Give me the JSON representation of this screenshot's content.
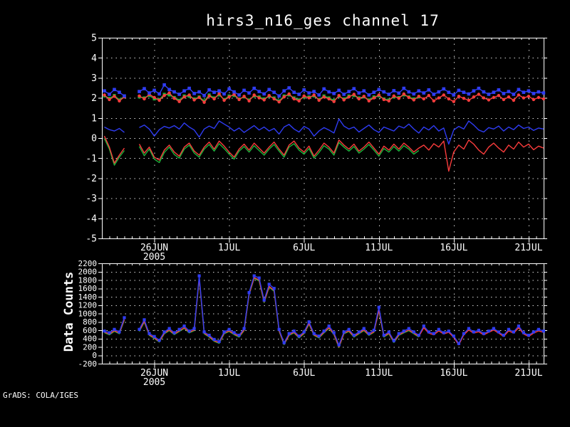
{
  "title": "hirs3_n16_ges channel 17",
  "attribution": "GrADS: COLA/IGES",
  "colors": {
    "background": "#000000",
    "axis": "#ffffff",
    "grid": "#d2d2d2",
    "blue": "#2f3cf2",
    "red": "#fa3c3c",
    "green": "#1eb43c"
  },
  "x_axis": {
    "range_days": [
      0,
      29.5
    ],
    "tick_days": [
      3.5,
      8.5,
      13.5,
      18.5,
      23.5,
      28.5
    ],
    "tick_labels": [
      "26JUN",
      "1JUL",
      "6JUL",
      "11JUL",
      "16JUL",
      "21JUL"
    ],
    "year_label": "2005",
    "points_start_day": 0.1667,
    "points_step_day": 0.3333
  },
  "chart_data": [
    {
      "type": "line",
      "title": "hirs3_n16_ges channel 17",
      "ylabel": "",
      "ylim": [
        -5,
        5
      ],
      "ytick_values": [
        5,
        4,
        3,
        2,
        1,
        0,
        -1,
        -2,
        -3,
        -4,
        -5
      ],
      "ytick_labels": [
        "5",
        "4",
        "3",
        "2",
        "1",
        "0",
        "-1",
        "-2",
        "-3",
        "-4",
        "-5"
      ],
      "grid": true,
      "legend": "none",
      "series": [
        {
          "name": "green_markers",
          "color": "green",
          "marker": "square",
          "marker_size": 4.2,
          "values": [
            2.1,
            1.98,
            2.12,
            1.9,
            2.08,
            null,
            null,
            2.05,
            2.0,
            2.12,
            1.95,
            1.92,
            2.18,
            2.15,
            2.02,
            1.88,
            2.1,
            2.08,
            1.95,
            2.05,
            1.85,
            2.15,
            2.0,
            2.15,
            1.92,
            2.1,
            2.12,
            1.95,
            2.05,
            1.9,
            2.1,
            2.05,
            1.95,
            2.08,
            2.0,
            1.85,
            2.1,
            2.15,
            2.0,
            1.9,
            2.05,
            2.05,
            2.1,
            1.92,
            2.1,
            2.0,
            1.88,
            2.08,
            1.95,
            2.1,
            2.12,
            2.0,
            2.05,
            1.9,
            2.05,
            2.1,
            1.95,
            1.9,
            2.05,
            2.02,
            2.15,
            2.05,
            1.95,
            2.05,
            null,
            null,
            null,
            null,
            null,
            null,
            null,
            null,
            null,
            null,
            null,
            null,
            null,
            null,
            null,
            null,
            null,
            null,
            null,
            null,
            null,
            null,
            null,
            null,
            null
          ]
        },
        {
          "name": "red_markers",
          "color": "red",
          "marker": "dot",
          "marker_size": 2.2,
          "values": [
            2.15,
            1.92,
            2.08,
            1.85,
            2.05,
            null,
            null,
            2.1,
            1.95,
            2.18,
            2.02,
            1.88,
            2.12,
            2.25,
            1.98,
            1.82,
            2.05,
            2.15,
            1.9,
            2.02,
            1.78,
            2.1,
            1.95,
            2.22,
            1.88,
            2.05,
            2.18,
            1.92,
            2.08,
            1.85,
            2.15,
            2.0,
            1.9,
            2.12,
            1.95,
            1.8,
            2.05,
            2.2,
            1.95,
            1.85,
            2.1,
            2.0,
            2.15,
            1.88,
            2.05,
            1.95,
            1.82,
            2.12,
            1.9,
            2.05,
            2.18,
            1.95,
            2.08,
            1.85,
            2.0,
            2.15,
            1.92,
            1.85,
            2.1,
            1.98,
            2.2,
            2.02,
            1.9,
            2.08,
            1.95,
            2.12,
            1.85,
            2.0,
            2.15,
            1.95,
            1.82,
            2.08,
            1.98,
            1.88,
            2.05,
            2.18,
            2.0,
            1.9,
            2.02,
            2.12,
            1.92,
            2.05,
            1.88,
            2.15,
            2.0,
            2.08,
            1.92,
            2.02,
            1.95
          ]
        },
        {
          "name": "blue_markers",
          "color": "blue",
          "marker": "square",
          "marker_size": 4.6,
          "values": [
            2.35,
            2.18,
            2.42,
            2.28,
            2.1,
            null,
            null,
            2.32,
            2.46,
            2.25,
            2.38,
            2.2,
            2.65,
            2.42,
            2.3,
            2.18,
            2.35,
            2.48,
            2.22,
            2.3,
            2.12,
            2.4,
            2.28,
            2.35,
            2.2,
            2.45,
            2.3,
            2.15,
            2.38,
            2.25,
            2.48,
            2.32,
            2.2,
            2.42,
            2.28,
            2.1,
            2.35,
            2.5,
            2.28,
            2.18,
            2.4,
            2.25,
            2.32,
            2.15,
            2.45,
            2.3,
            2.22,
            2.38,
            2.18,
            2.32,
            2.46,
            2.25,
            2.35,
            2.15,
            2.28,
            2.42,
            2.3,
            2.18,
            2.36,
            2.24,
            2.48,
            2.3,
            2.2,
            2.35,
            2.25,
            2.4,
            2.18,
            2.3,
            2.45,
            2.28,
            2.15,
            2.38,
            2.28,
            2.2,
            2.35,
            2.48,
            2.3,
            2.18,
            2.28,
            2.4,
            2.22,
            2.32,
            2.18,
            2.42,
            2.28,
            2.35,
            2.22,
            2.3,
            2.25
          ]
        },
        {
          "name": "green_line",
          "color": "green",
          "marker": null,
          "marker_size": 0,
          "values": [
            -0.02,
            -0.55,
            -1.35,
            -0.95,
            -0.62,
            null,
            null,
            -0.42,
            -0.88,
            -0.55,
            -1.05,
            -1.22,
            -0.72,
            -0.45,
            -0.82,
            -1.0,
            -0.55,
            -0.35,
            -0.75,
            -0.95,
            -0.55,
            -0.32,
            -0.65,
            -0.28,
            -0.52,
            -0.8,
            -1.05,
            -0.65,
            -0.42,
            -0.7,
            -0.38,
            -0.62,
            -0.85,
            -0.55,
            -0.32,
            -0.65,
            -0.95,
            -0.45,
            -0.28,
            -0.6,
            -0.8,
            -0.52,
            -1.0,
            -0.72,
            -0.38,
            -0.55,
            -0.85,
            -0.22,
            -0.45,
            -0.65,
            -0.42,
            -0.75,
            -0.55,
            -0.32,
            -0.6,
            -0.9,
            -0.52,
            -0.7,
            -0.42,
            -0.65,
            -0.38,
            -0.55,
            -0.8,
            -0.62,
            null,
            null,
            null,
            null,
            null,
            null,
            null,
            null,
            null,
            null,
            null,
            null,
            null,
            null,
            null,
            null,
            null,
            null,
            null,
            null,
            null,
            null,
            null,
            null,
            null
          ]
        },
        {
          "name": "red_line",
          "color": "red",
          "marker": null,
          "marker_size": 0,
          "values": [
            0.1,
            -0.45,
            -1.25,
            -0.85,
            -0.5,
            null,
            null,
            -0.3,
            -0.75,
            -0.45,
            -0.95,
            -1.1,
            -0.6,
            -0.35,
            -0.7,
            -0.9,
            -0.45,
            -0.25,
            -0.65,
            -0.85,
            -0.45,
            -0.2,
            -0.55,
            -0.15,
            -0.4,
            -0.7,
            -0.95,
            -0.55,
            -0.3,
            -0.6,
            -0.25,
            -0.5,
            -0.75,
            -0.45,
            -0.2,
            -0.55,
            -0.85,
            -0.35,
            -0.15,
            -0.5,
            -0.7,
            -0.4,
            -0.9,
            -0.6,
            -0.25,
            -0.45,
            -0.75,
            -0.1,
            -0.35,
            -0.55,
            -0.3,
            -0.65,
            -0.45,
            -0.2,
            -0.5,
            -0.8,
            -0.4,
            -0.6,
            -0.3,
            -0.55,
            -0.25,
            -0.45,
            -0.7,
            -0.5,
            -0.35,
            -0.6,
            -0.28,
            -0.45,
            -0.15,
            -1.65,
            -0.7,
            -0.35,
            -0.55,
            -0.1,
            -0.3,
            -0.6,
            -0.8,
            -0.45,
            -0.25,
            -0.5,
            -0.7,
            -0.35,
            -0.55,
            -0.2,
            -0.45,
            -0.3,
            -0.58,
            -0.4,
            -0.5
          ]
        },
        {
          "name": "blue_line",
          "color": "blue",
          "marker": null,
          "marker_size": 0,
          "values": [
            0.55,
            0.42,
            0.35,
            0.48,
            0.28,
            null,
            null,
            0.52,
            0.65,
            0.45,
            0.1,
            0.42,
            0.58,
            0.5,
            0.62,
            0.45,
            0.75,
            0.55,
            0.4,
            0.05,
            0.45,
            0.6,
            0.48,
            0.85,
            0.7,
            0.55,
            0.35,
            0.5,
            0.28,
            0.45,
            0.62,
            0.4,
            0.55,
            0.35,
            0.48,
            0.2,
            0.55,
            0.68,
            0.45,
            0.3,
            0.58,
            0.45,
            0.1,
            0.35,
            0.52,
            0.4,
            0.25,
            0.95,
            0.6,
            0.45,
            0.55,
            0.3,
            0.48,
            0.65,
            0.42,
            0.28,
            0.55,
            0.45,
            0.35,
            0.6,
            0.5,
            0.7,
            0.45,
            0.25,
            0.55,
            0.4,
            0.62,
            0.35,
            0.5,
            -0.3,
            0.4,
            0.58,
            0.45,
            0.85,
            0.65,
            0.4,
            0.3,
            0.52,
            0.45,
            0.6,
            0.35,
            0.55,
            0.42,
            0.65,
            0.48,
            0.55,
            0.38,
            0.5,
            0.45
          ]
        }
      ]
    },
    {
      "type": "line",
      "title": "",
      "ylabel": "Data Counts",
      "ylim": [
        -200,
        2200
      ],
      "ytick_values": [
        2200,
        2000,
        1800,
        1600,
        1400,
        1200,
        1000,
        800,
        600,
        400,
        200,
        0,
        -200
      ],
      "ytick_labels": [
        "2200",
        "2000",
        "1800",
        "1600",
        "1400",
        "1200",
        "1000",
        "800",
        "600",
        "400",
        "200",
        "0",
        "-200"
      ],
      "grid": true,
      "legend": "none",
      "series": [
        {
          "name": "green_counts",
          "color": "green",
          "marker": null,
          "marker_size": 0,
          "values": [
            540,
            490,
            575,
            515,
            840,
            null,
            null,
            570,
            795,
            475,
            405,
            315,
            515,
            590,
            495,
            570,
            645,
            535,
            590,
            1830,
            515,
            435,
            335,
            285,
            515,
            570,
            495,
            435,
            590,
            1440,
            1840,
            1780,
            1260,
            1630,
            1530,
            575,
            255,
            475,
            535,
            415,
            515,
            745,
            475,
            415,
            535,
            645,
            495,
            185,
            515,
            570,
            435,
            515,
            590,
            475,
            550,
            1060,
            435,
            515,
            305,
            475,
            535,
            590,
            515,
            435,
            null,
            null,
            null,
            null,
            null,
            null,
            null,
            null,
            null,
            null,
            null,
            null,
            null,
            null,
            null,
            null,
            null,
            null,
            null,
            null,
            null,
            null,
            null,
            null,
            null
          ]
        },
        {
          "name": "red_counts",
          "color": "red",
          "marker": null,
          "marker_size": 0,
          "values": [
            555,
            505,
            590,
            530,
            860,
            null,
            null,
            585,
            815,
            490,
            420,
            330,
            530,
            605,
            510,
            585,
            660,
            550,
            605,
            1850,
            530,
            450,
            350,
            300,
            530,
            585,
            510,
            450,
            605,
            1460,
            1860,
            1800,
            1280,
            1650,
            1550,
            590,
            270,
            490,
            550,
            430,
            530,
            760,
            490,
            430,
            550,
            660,
            510,
            200,
            530,
            585,
            450,
            530,
            605,
            490,
            565,
            1080,
            450,
            530,
            320,
            490,
            550,
            605,
            530,
            450,
            660,
            530,
            490,
            585,
            510,
            550,
            430,
            250,
            490,
            605,
            530,
            565,
            490,
            550,
            605,
            530,
            450,
            585,
            530,
            660,
            510,
            450,
            530,
            585,
            550
          ]
        },
        {
          "name": "blue_counts",
          "color": "blue",
          "marker": "square",
          "marker_size": 4.2,
          "values": [
            580,
            540,
            620,
            560,
            900,
            null,
            null,
            620,
            850,
            520,
            450,
            360,
            560,
            640,
            540,
            620,
            700,
            580,
            640,
            1900,
            560,
            480,
            380,
            330,
            560,
            620,
            540,
            480,
            640,
            1500,
            1900,
            1850,
            1320,
            1700,
            1600,
            620,
            300,
            520,
            580,
            460,
            560,
            800,
            520,
            460,
            580,
            700,
            540,
            250,
            560,
            620,
            480,
            560,
            640,
            520,
            600,
            1150,
            480,
            560,
            350,
            520,
            580,
            640,
            560,
            480,
            700,
            560,
            520,
            620,
            540,
            580,
            460,
            280,
            520,
            640,
            560,
            600,
            520,
            580,
            640,
            560,
            480,
            620,
            560,
            700,
            540,
            480,
            560,
            620,
            580
          ]
        }
      ]
    }
  ]
}
